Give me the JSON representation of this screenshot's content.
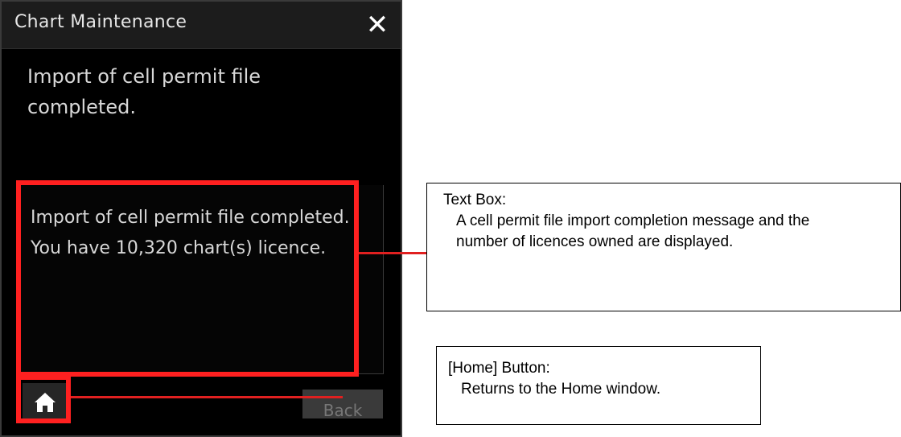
{
  "dialog": {
    "title": "Chart Maintenance",
    "close_label": "✕",
    "header_message": "Import of cell permit file completed.",
    "textbox_line1": "Import of cell permit file completed.",
    "textbox_line2": "You have 10,320 chart(s) licence.",
    "back_label": "Back",
    "home_icon": "home-icon"
  },
  "callouts": {
    "textbox": {
      "heading": "Text Box:",
      "body": "A cell permit file import completion message and the number of licences owned are displayed."
    },
    "home": {
      "heading": "[Home] Button:",
      "body": "Returns to the Home window."
    }
  },
  "colors": {
    "highlight": "#ff2020",
    "panel": "#000000",
    "text": "#d8d8d8"
  }
}
